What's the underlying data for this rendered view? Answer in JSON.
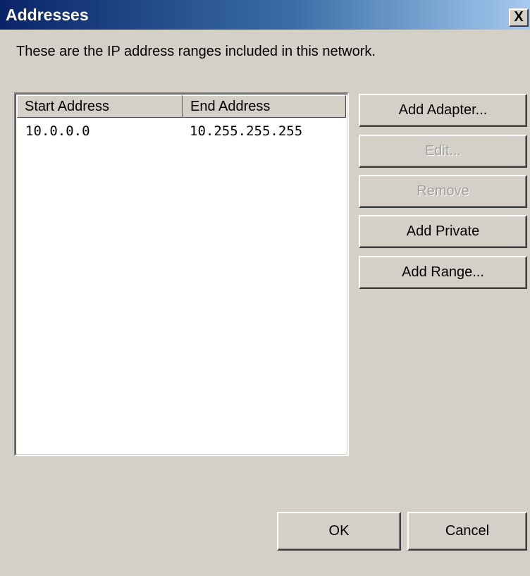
{
  "window": {
    "title": "Addresses",
    "close_glyph": "X"
  },
  "description": "These are the IP address ranges included in this network.",
  "list": {
    "columns": [
      "Start Address",
      "End Address"
    ],
    "rows": [
      {
        "start": "10.0.0.0",
        "end": "10.255.255.255"
      }
    ]
  },
  "buttons": {
    "add_adapter": "Add Adapter...",
    "edit": "Edit...",
    "remove": "Remove",
    "add_private": "Add Private",
    "add_range": "Add Range...",
    "ok": "OK",
    "cancel": "Cancel"
  },
  "colors": {
    "titlebar_start": "#0a246a",
    "titlebar_end": "#a6caf0",
    "dialog_bg": "#d4d0c8"
  }
}
